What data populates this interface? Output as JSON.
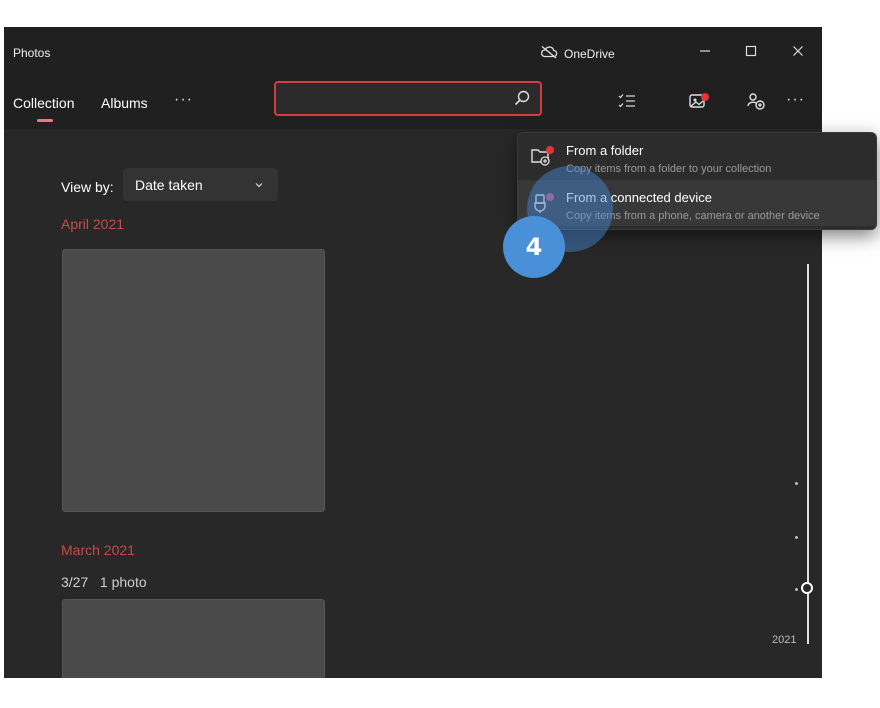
{
  "window": {
    "app_title": "Photos",
    "onedrive_label": "OneDrive",
    "controls": {
      "minimize": "–",
      "maximize": "☐",
      "close": "✕"
    }
  },
  "nav": {
    "tabs": [
      {
        "label": "Collection",
        "active": true
      },
      {
        "label": "Albums",
        "active": false
      }
    ],
    "more_label": "···",
    "search": {
      "value": "",
      "placeholder": ""
    },
    "toolbar_more_label": "···"
  },
  "content": {
    "viewby_label": "View by:",
    "viewby_value": "Date taken",
    "groups": [
      {
        "month": "April 2021"
      },
      {
        "month": "March 2021",
        "date": "3/27",
        "count": "1 photo"
      }
    ],
    "timeline_year": "2021"
  },
  "import_menu": {
    "items": [
      {
        "title": "From a folder",
        "subtitle": "Copy items from a folder to your collection"
      },
      {
        "title": "From a connected device",
        "subtitle": "Copy items from a phone, camera or another device"
      }
    ]
  },
  "step_badge": "4",
  "colors": {
    "accent_red": "#d53c3c",
    "month_red": "#c94a4a",
    "badge_blue": "#4a90d9"
  }
}
